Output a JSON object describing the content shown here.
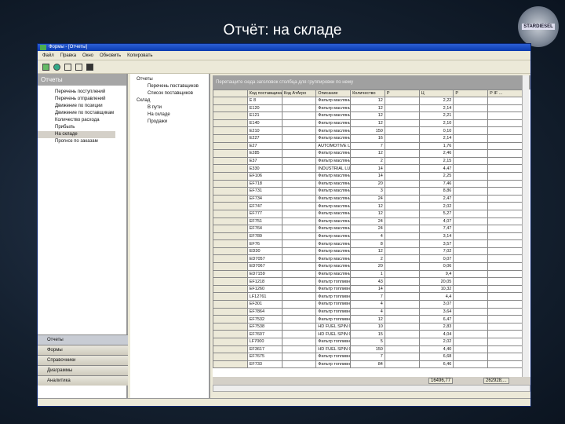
{
  "slide_title": "Отчёт: на складе",
  "logo_text": "STARDIESEL",
  "window": {
    "title": "Формы - [Отчеты]"
  },
  "menu": [
    "Файл",
    "Правка",
    "Окно",
    "Обновить",
    "Копировать"
  ],
  "left": {
    "header": "Отчеты",
    "items": [
      "Перечень поступлений",
      "Перечень отправлений",
      "Движение по позиции",
      "Движение по поставщикам",
      "Количество расхода",
      "Прибыль",
      "На складе",
      "Прогноз по заказам"
    ],
    "selected": 6,
    "nav": [
      "Отчеты",
      "Формы",
      "Справочники",
      "Диаграммы",
      "Аналитика"
    ]
  },
  "mid": {
    "items": [
      "Отчеты",
      "Перечень поставщиков",
      "Список поставщиков",
      "Склад",
      "В пути",
      "На складе",
      "Продажи"
    ]
  },
  "grid": {
    "caption": "Перетащите сюда заголовок столбца для группировки по нему",
    "columns": [
      "Код поставщика",
      "Код АтАгро",
      "Описание",
      "Количество",
      "Р",
      "Ц",
      "Р",
      "Р IF ..."
    ],
    "rows": [
      [
        "E 8",
        "",
        "Фильтр масляный AL",
        "12",
        "",
        "2,22"
      ],
      [
        "E120",
        "",
        "Фильтр масляный AL",
        "12",
        "",
        "2,14"
      ],
      [
        "E121",
        "",
        "Фильтр масляный AL",
        "12",
        "",
        "2,21"
      ],
      [
        "E140",
        "",
        "Фильтр масляный AL",
        "12",
        "",
        "2,10"
      ],
      [
        "E210",
        "",
        "Фильтр масляный",
        "150",
        "",
        "0,10"
      ],
      [
        "E227",
        "",
        "Фильтр масляный AL",
        "16",
        "",
        "2,14"
      ],
      [
        "E27",
        "",
        "AUTOMOTIVE LUBE S",
        "7",
        "",
        "1,76"
      ],
      [
        "E285",
        "",
        "Фильтр масляный AL",
        "12",
        "",
        "2,46"
      ],
      [
        "E37",
        "",
        "Фильтр масляный AL",
        "2",
        "",
        "2,15"
      ],
      [
        "E330",
        "",
        "INDUSTRIAL LUBE EL",
        "14",
        "",
        "4,47"
      ],
      [
        "EF106",
        "",
        "Фильтр масляный",
        "14",
        "",
        "2,25"
      ],
      [
        "EF718",
        "",
        "Фильтр масляный",
        "20",
        "",
        "7,46"
      ],
      [
        "EF731",
        "",
        "Фильтр масляный",
        "3",
        "",
        "8,86"
      ],
      [
        "EF734",
        "",
        "Фильтр масляный",
        "24",
        "",
        "2,47"
      ],
      [
        "EF747",
        "",
        "Фильтр масляный",
        "12",
        "",
        "2,02"
      ],
      [
        "EF777",
        "",
        "Фильтр масляный",
        "12",
        "",
        "5,27"
      ],
      [
        "EF751",
        "",
        "Фильтр масляный",
        "24",
        "",
        "4,07"
      ],
      [
        "EF764",
        "",
        "Фильтр масляный",
        "24",
        "",
        "7,47"
      ],
      [
        "EF789",
        "",
        "Фильтр масляный",
        "4",
        "",
        "3,14"
      ],
      [
        "EF76",
        "",
        "Фильтр масляный",
        "8",
        "",
        "3,57"
      ],
      [
        "ED30",
        "",
        "Фильтр масляный AL",
        "12",
        "",
        "7,02"
      ],
      [
        "ED7057",
        "",
        "Фильтр масляный",
        "2",
        "",
        "0,07"
      ],
      [
        "ED7067",
        "",
        "Фильтр масляный",
        "20",
        "",
        "0,06"
      ],
      [
        "ED7159",
        "",
        "Фильтр масляный",
        "1",
        "",
        "9,4"
      ],
      [
        "EF1218",
        "",
        "Фильтр топливный TD",
        "43",
        "",
        "20,05"
      ],
      [
        "EF1260",
        "",
        "Фильтр топливный TD",
        "14",
        "",
        "10,32"
      ],
      [
        "LF12761",
        "",
        "Фильтр топливный",
        "7",
        "",
        "4,4"
      ],
      [
        "EF301",
        "",
        "Фильтр топливный TD",
        "4",
        "",
        "3,07"
      ],
      [
        "EF7864",
        "",
        "Фильтр топливный TD",
        "4",
        "",
        "3,64"
      ],
      [
        "EF7532",
        "",
        "Фильтр топливный TD",
        "12",
        "",
        "6,47"
      ],
      [
        "EF7538",
        "",
        "HD FUEL SPIN ON ELE",
        "10",
        "",
        "2,83"
      ],
      [
        "EF7607",
        "",
        "HD FUEL SPIN ON ELE",
        "15",
        "",
        "4,04"
      ],
      [
        "LF7000",
        "",
        "Фильтр топливный TD",
        "5",
        "",
        "2,02"
      ],
      [
        "EF3617",
        "",
        "HD FUEL SPIN ON TD",
        "150",
        "",
        "4,40"
      ],
      [
        "EF7675",
        "",
        "Фильтр топливный TD",
        "7",
        "",
        "6,68"
      ],
      [
        "EF733",
        "",
        "Фильтр топливный TD",
        "84",
        "",
        "6,46"
      ]
    ],
    "total_price": "16496,77",
    "total_last": "262928,..."
  }
}
